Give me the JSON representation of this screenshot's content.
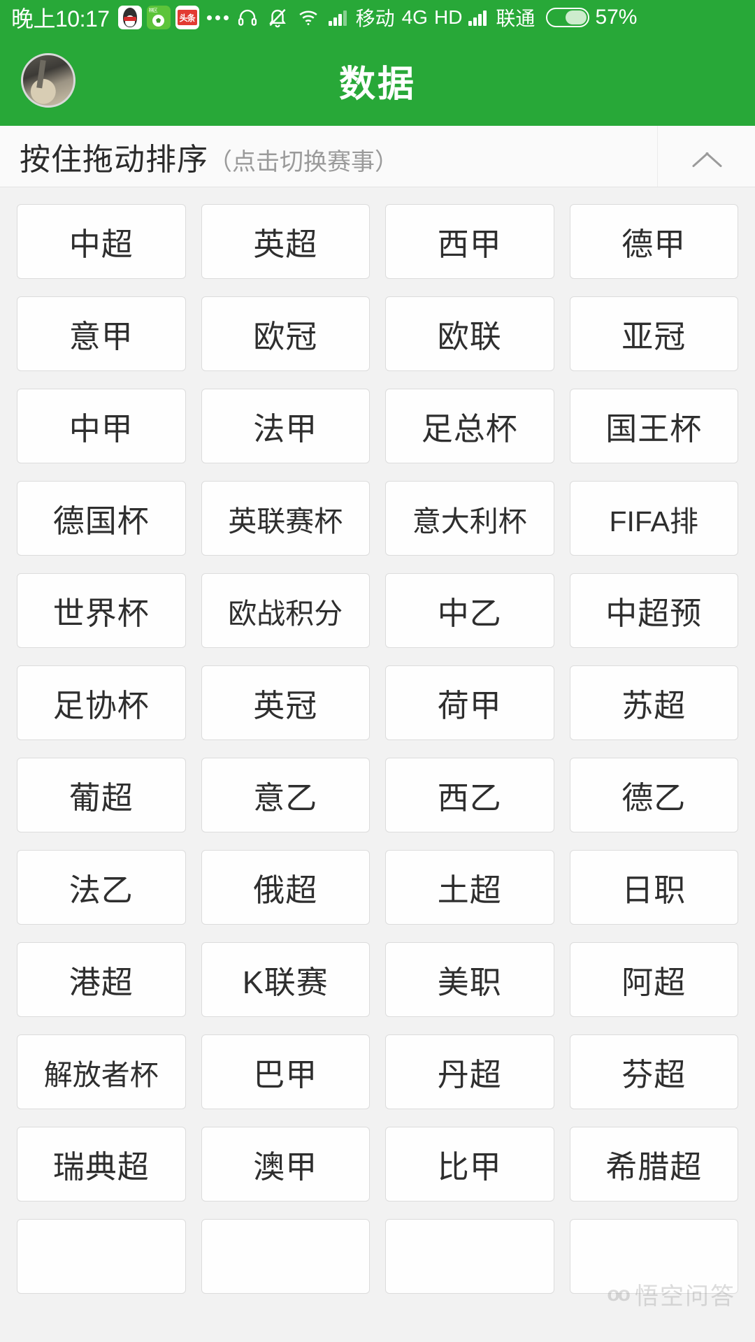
{
  "status_bar": {
    "time": "晚上10:17",
    "app_icons": [
      "qq-icon",
      "football-app-icon",
      "toutiao-icon"
    ],
    "overflow_dots": "…",
    "headset_icon": "headset-icon",
    "silent_icon": "bell-muted-icon",
    "wifi_icon": "wifi-icon",
    "carrier_1": "移动",
    "network_type": "4G",
    "hd_label": "HD",
    "carrier_2": "联通",
    "battery_percent": "57%"
  },
  "header": {
    "title": "数据",
    "avatar": "user-avatar"
  },
  "sort_bar": {
    "main_label": "按住拖动排序",
    "sub_label": "（点击切换赛事）",
    "collapse_icon": "chevron-up-icon"
  },
  "leagues": [
    "中超",
    "英超",
    "西甲",
    "德甲",
    "意甲",
    "欧冠",
    "欧联",
    "亚冠",
    "中甲",
    "法甲",
    "足总杯",
    "国王杯",
    "德国杯",
    "英联赛杯",
    "意大利杯",
    "FIFA排",
    "世界杯",
    "欧战积分",
    "中乙",
    "中超预",
    "足协杯",
    "英冠",
    "荷甲",
    "苏超",
    "葡超",
    "意乙",
    "西乙",
    "德乙",
    "法乙",
    "俄超",
    "土超",
    "日职",
    "港超",
    "K联赛",
    "美职",
    "阿超",
    "解放者杯",
    "巴甲",
    "丹超",
    "芬超",
    "瑞典超",
    "澳甲",
    "比甲",
    "希腊超",
    "",
    "",
    "",
    ""
  ],
  "watermark": {
    "glyph": "oo",
    "text": "悟空问答"
  },
  "colors": {
    "brand_green": "#28a838",
    "page_background": "#f2f2f2",
    "tile_background": "#fefefe",
    "tile_border": "#dcdcdc",
    "text_primary": "#2e2e2e",
    "text_muted": "#9a9a9a"
  }
}
